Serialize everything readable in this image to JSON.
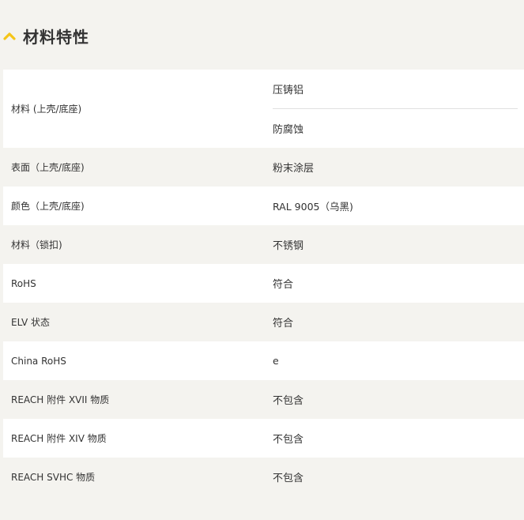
{
  "section": {
    "title": "材料特性",
    "icon": "chevron-up-icon",
    "accent_color": "#f5c518"
  },
  "rows": [
    {
      "label": "材料 (上壳/底座)",
      "values": [
        "压铸铝",
        "防腐蚀"
      ]
    },
    {
      "label": "表面（上壳/底座)",
      "value": "粉末涂层"
    },
    {
      "label": "颜色（上壳/底座)",
      "value": "RAL 9005（乌黑)"
    },
    {
      "label": "材料（锁扣)",
      "value": "不锈钢"
    },
    {
      "label": "RoHS",
      "value": "符合"
    },
    {
      "label": "ELV 状态",
      "value": "符合"
    },
    {
      "label": "China RoHS",
      "value": "e"
    },
    {
      "label": "REACH 附件 XVII 物质",
      "value": "不包含"
    },
    {
      "label": "REACH 附件 XIV 物质",
      "value": "不包含"
    },
    {
      "label": "REACH SVHC 物质",
      "value": "不包含"
    }
  ]
}
